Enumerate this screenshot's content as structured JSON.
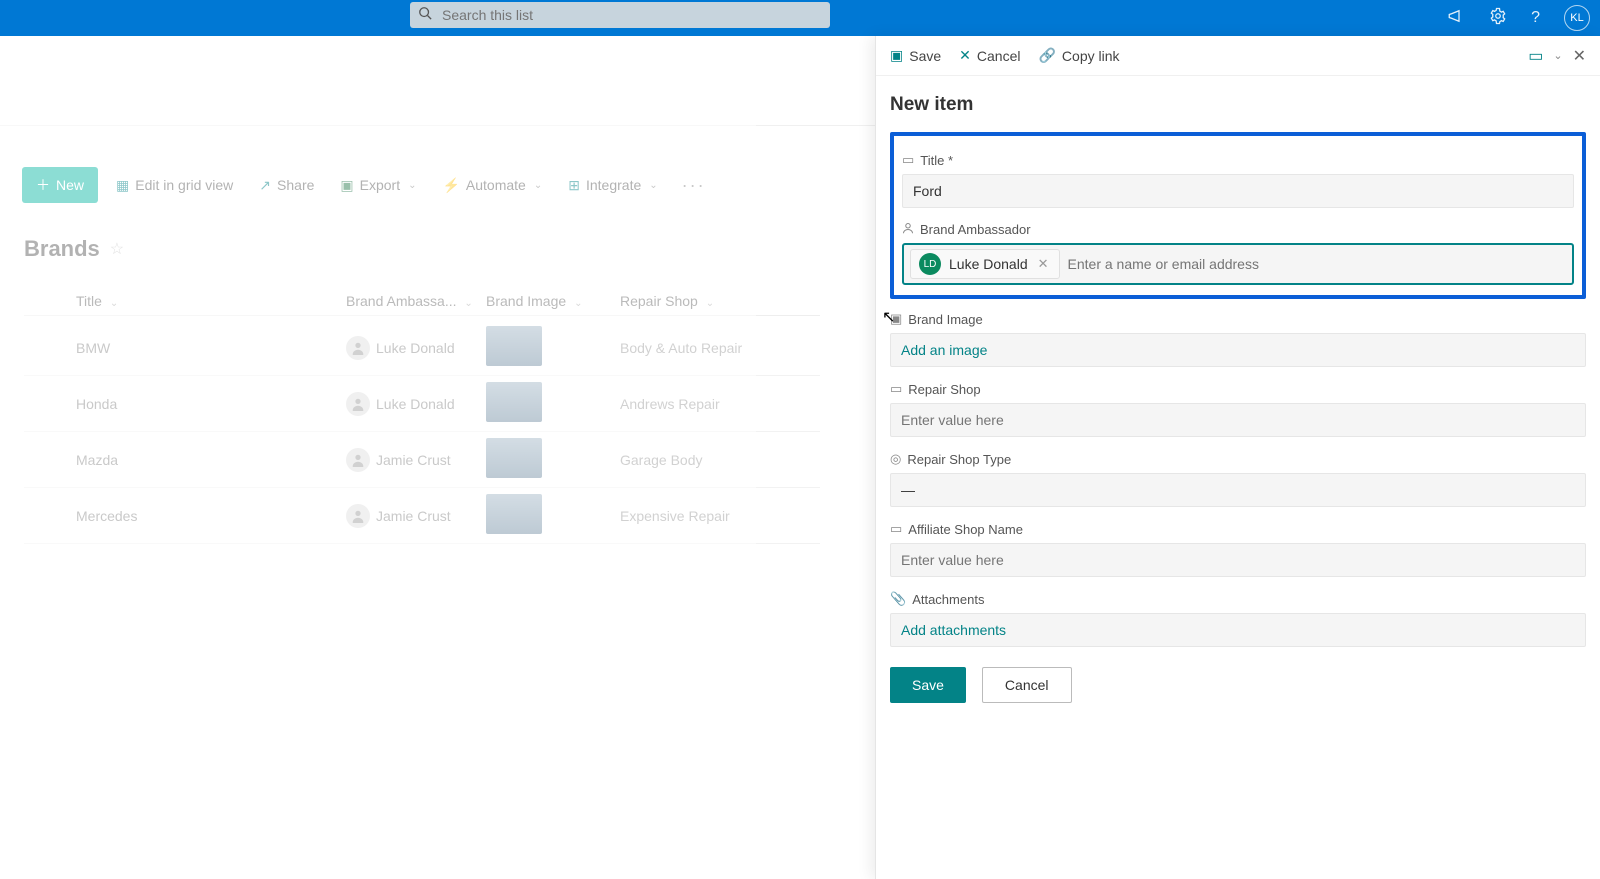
{
  "topbar": {
    "search_placeholder": "Search this list",
    "user_initials": "KL"
  },
  "commands": {
    "new": "New",
    "edit_grid": "Edit in grid view",
    "share": "Share",
    "export": "Export",
    "automate": "Automate",
    "integrate": "Integrate"
  },
  "list": {
    "title": "Brands",
    "columns": {
      "title": "Title",
      "ambassador": "Brand Ambassa...",
      "image": "Brand Image",
      "shop": "Repair Shop"
    },
    "rows": [
      {
        "title": "BMW",
        "ambassador": "Luke Donald",
        "shop": "Body & Auto Repair"
      },
      {
        "title": "Honda",
        "ambassador": "Luke Donald",
        "shop": "Andrews Repair"
      },
      {
        "title": "Mazda",
        "ambassador": "Jamie Crust",
        "shop": "Garage Body"
      },
      {
        "title": "Mercedes",
        "ambassador": "Jamie Crust",
        "shop": "Expensive Repair"
      }
    ]
  },
  "panel": {
    "actions": {
      "save": "Save",
      "cancel": "Cancel",
      "copy_link": "Copy link"
    },
    "heading": "New item",
    "fields": {
      "title_label": "Title *",
      "title_value": "Ford",
      "ambassador_label": "Brand Ambassador",
      "ambassador_chip_name": "Luke Donald",
      "ambassador_chip_initials": "LD",
      "ambassador_placeholder": "Enter a name or email address",
      "image_label": "Brand Image",
      "image_link": "Add an image",
      "repair_shop_label": "Repair Shop",
      "repair_shop_placeholder": "Enter value here",
      "repair_shop_type_label": "Repair Shop Type",
      "repair_shop_type_value": "—",
      "affiliate_label": "Affiliate Shop Name",
      "affiliate_placeholder": "Enter value here",
      "attachments_label": "Attachments",
      "attachments_link": "Add attachments"
    },
    "buttons": {
      "save": "Save",
      "cancel": "Cancel"
    }
  }
}
